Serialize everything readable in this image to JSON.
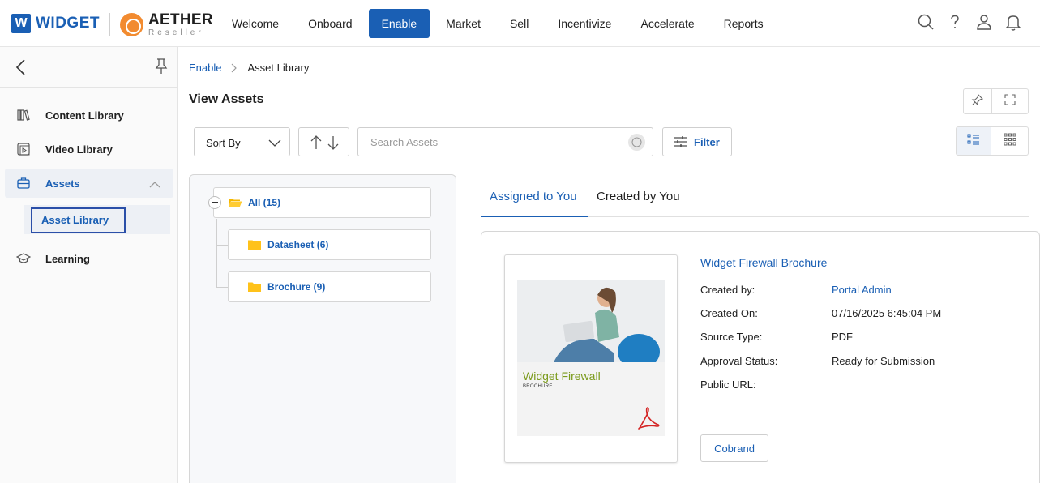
{
  "brand": {
    "widget_badge": "W",
    "widget_name": "WIDGET",
    "aether_name": "AETHER",
    "aether_sub": "Reseller"
  },
  "nav": {
    "items": [
      "Welcome",
      "Onboard",
      "Enable",
      "Market",
      "Sell",
      "Incentivize",
      "Accelerate",
      "Reports"
    ],
    "active": "Enable"
  },
  "sidebar": {
    "items": [
      {
        "label": "Content Library",
        "icon": "books-icon"
      },
      {
        "label": "Video Library",
        "icon": "video-icon"
      },
      {
        "label": "Assets",
        "icon": "briefcase-icon"
      },
      {
        "label": "Learning",
        "icon": "graduation-cap-icon"
      }
    ],
    "sub_item": "Asset Library"
  },
  "breadcrumb": {
    "parent": "Enable",
    "current": "Asset Library"
  },
  "page": {
    "title": "View Assets"
  },
  "toolbar": {
    "sort_label": "Sort By",
    "search_placeholder": "Search Assets",
    "filter_label": "Filter"
  },
  "tree": {
    "root": "All (15)",
    "children": [
      "Datasheet (6)",
      "Brochure (9)"
    ]
  },
  "tabs": {
    "assigned": "Assigned to You",
    "created": "Created by You"
  },
  "asset": {
    "name": "Widget Firewall Brochure",
    "thumb_title": "Widget Firewall",
    "thumb_sub": "BROCHURE",
    "fields": [
      {
        "label": "Created by:",
        "value": "Portal Admin"
      },
      {
        "label": "Created On:",
        "value": "07/16/2025 6:45:04 PM"
      },
      {
        "label": "Source Type:",
        "value": "PDF"
      },
      {
        "label": "Approval Status:",
        "value": "Ready for Submission"
      },
      {
        "label": "Public URL:",
        "value": ""
      }
    ],
    "cobrand_label": "Cobrand"
  },
  "colors": {
    "accent": "#1a5fb4",
    "brand_orange": "#f28b30",
    "thumb_title_green": "#7a9a1a",
    "pdf_red": "#d42424"
  }
}
